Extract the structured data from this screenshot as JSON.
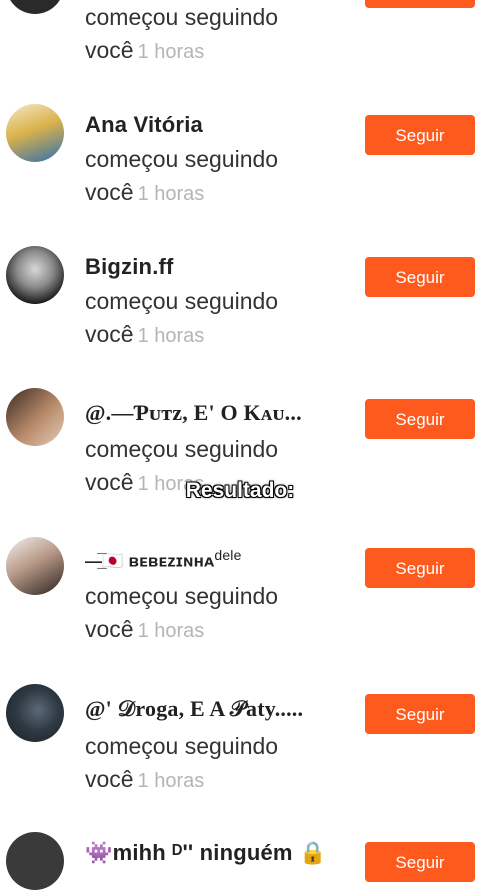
{
  "follow_label": "Seguir",
  "action_line1": "começou seguindo",
  "action_line2": "você",
  "time_ago": "1 horas",
  "caption": "Resultado:",
  "items": [
    {
      "name": ""
    },
    {
      "name": "Ana Vitória"
    },
    {
      "name": "Bigzin.ff"
    },
    {
      "name": "@.—Ƥᴜᴛᴢ, E' O Kᴀᴜ..."
    },
    {
      "name": "—̲̅🇯🇵 ʙᴇʙᴇᴢɪɴʜᴀ",
      "sup": "dele"
    },
    {
      "name": "@' 𝒟roga, E A 𝒫aty....."
    },
    {
      "name": "👾mihh ᴰ'' ninguém 🔒"
    }
  ]
}
